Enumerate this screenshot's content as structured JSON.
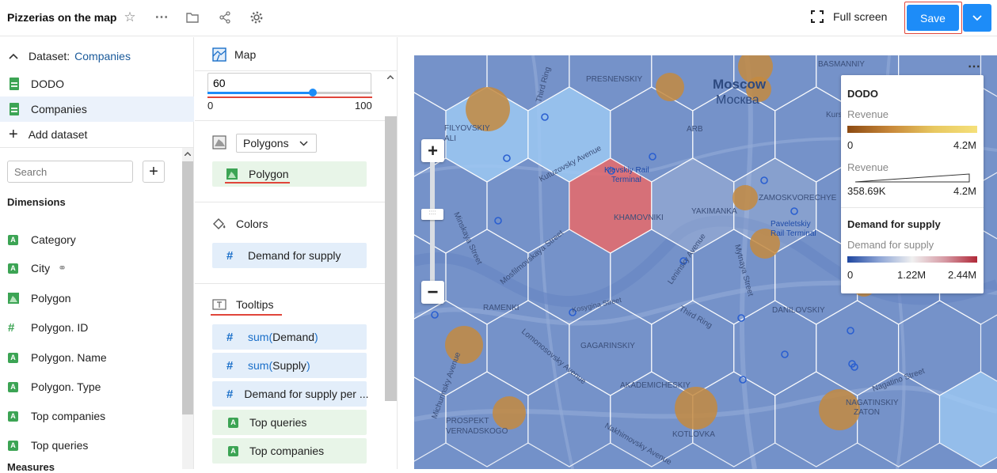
{
  "header": {
    "title": "Pizzerias on the map",
    "fullscreen_label": "Full screen",
    "save_label": "Save"
  },
  "left": {
    "dataset_label": "Dataset:",
    "dataset_name": "Companies",
    "datasets": [
      {
        "label": "DODO"
      },
      {
        "label": "Companies"
      }
    ],
    "add_dataset_label": "Add dataset",
    "search_placeholder": "Search",
    "dimensions_title": "Dimensions",
    "dimensions": [
      {
        "label": "Category",
        "type": "A"
      },
      {
        "label": "City",
        "type": "A"
      },
      {
        "label": "Polygon",
        "type": "geo"
      },
      {
        "label": "Polygon. ID",
        "type": "#"
      },
      {
        "label": "Polygon. Name",
        "type": "A"
      },
      {
        "label": "Polygon. Type",
        "type": "A"
      },
      {
        "label": "Top companies",
        "type": "A"
      },
      {
        "label": "Top queries",
        "type": "A"
      }
    ],
    "measures_title": "Measures"
  },
  "mid": {
    "chart_type_label": "Map",
    "opacity_value": "60",
    "slider_min": "0",
    "slider_max": "100",
    "slider_level": 0.6,
    "layer_type": "Polygons",
    "polygon_field": "Polygon",
    "colors_label": "Colors",
    "colors_field": "Demand for supply",
    "tooltips_label": "Tooltips",
    "tooltips": [
      {
        "prefix": "sum(",
        "name": "Demand",
        "suffix": ")",
        "type": "#"
      },
      {
        "prefix": "sum(",
        "name": "Supply",
        "suffix": ")",
        "type": "#"
      },
      {
        "prefix": "",
        "name": "Demand for supply per ...",
        "suffix": "",
        "type": "#"
      },
      {
        "prefix": "",
        "name": "Top queries",
        "suffix": "",
        "type": "A"
      },
      {
        "prefix": "",
        "name": "Top companies",
        "suffix": "",
        "type": "A"
      }
    ]
  },
  "legend": {
    "title1": "DODO",
    "revenue_label": "Revenue",
    "rev_min": "0",
    "rev_max": "4.2M",
    "size_label": "Revenue",
    "size_min": "358.69K",
    "size_max": "4.2M",
    "title2": "Demand for supply",
    "dfs_label": "Demand for supply",
    "dfs_min": "0",
    "dfs_mid": "1.22M",
    "dfs_max": "2.44M"
  },
  "map_labels": {
    "moscow": "Moscow",
    "moscow_ru": "Москва",
    "presnensky": "PRESNENSKIY",
    "basmanny": "BASMANNIY",
    "filyovsky": "FILYOVSKIY",
    "kutuzovsky": "Kutuzovsky Avenue",
    "kiev_rail": "Kievskiy Rail",
    "terminal": "Terminal",
    "khamovniki": "KHAMOVNIKI",
    "yakimanka": "YAKIMANKA",
    "zamoskvorechye": "ZAMOSKVORECHYE",
    "paveletsky": "Paveletskiy",
    "paveletsky2": "Rail Terminal",
    "third_ring": "Third Ring",
    "ramenki": "RAMENKI",
    "kosygina": "Kosygina Street",
    "leninsky": "Leninsky Avenue",
    "gagarinsky": "GAGARINSKIY",
    "danilovsky": "DANILOVSKIY",
    "akademichesky": "AKADEMICHESKIY",
    "nagatinsky": "NAGATINSKIY",
    "zaton": "ZATON",
    "kotlovka": "KOTLOVKA",
    "prospekt": "PROSPEKT",
    "vernadskogo": "VERNADSKOGO",
    "lomonosovsky": "Lomonosovsky Avenue",
    "nakhimovsky": "Nakhimovsky Avenue",
    "minskaya": "Minskaya Street",
    "mosfilmovskaya": "Mosfilmovskaya Street",
    "mytnaya": "Mytnaya Street",
    "michurinsky": "Michurinsky Avenue",
    "nagatino": "Nagatino Street",
    "kursky": "Kursk",
    "arbat": "ARB",
    "third_ring_top": "Third Ring",
    "third_ring_bot": "Third Ring"
  },
  "colors": {
    "accent": "#1d8cf8",
    "highlight": "#e0453a",
    "hex_base": "#6f8fc7",
    "pizza": "#c48a3f"
  }
}
